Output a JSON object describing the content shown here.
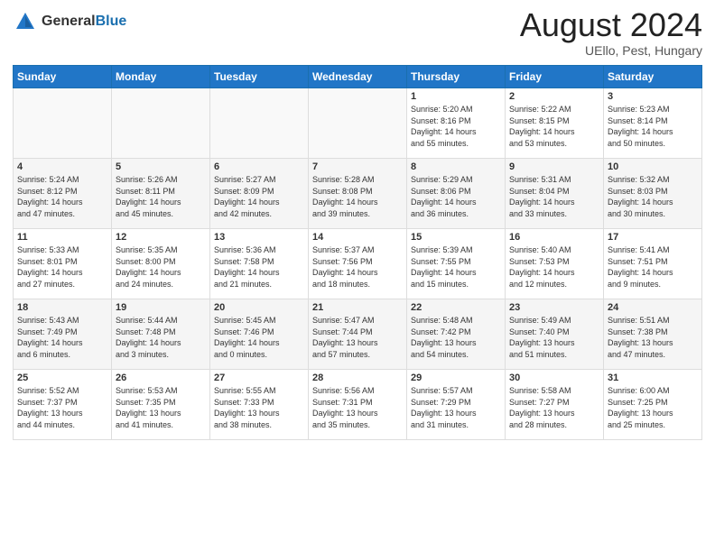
{
  "header": {
    "logo_general": "General",
    "logo_blue": "Blue",
    "month_title": "August 2024",
    "location": "UEllo, Pest, Hungary"
  },
  "days_of_week": [
    "Sunday",
    "Monday",
    "Tuesday",
    "Wednesday",
    "Thursday",
    "Friday",
    "Saturday"
  ],
  "weeks": [
    [
      {
        "day": "",
        "text": ""
      },
      {
        "day": "",
        "text": ""
      },
      {
        "day": "",
        "text": ""
      },
      {
        "day": "",
        "text": ""
      },
      {
        "day": "1",
        "text": "Sunrise: 5:20 AM\nSunset: 8:16 PM\nDaylight: 14 hours\nand 55 minutes."
      },
      {
        "day": "2",
        "text": "Sunrise: 5:22 AM\nSunset: 8:15 PM\nDaylight: 14 hours\nand 53 minutes."
      },
      {
        "day": "3",
        "text": "Sunrise: 5:23 AM\nSunset: 8:14 PM\nDaylight: 14 hours\nand 50 minutes."
      }
    ],
    [
      {
        "day": "4",
        "text": "Sunrise: 5:24 AM\nSunset: 8:12 PM\nDaylight: 14 hours\nand 47 minutes."
      },
      {
        "day": "5",
        "text": "Sunrise: 5:26 AM\nSunset: 8:11 PM\nDaylight: 14 hours\nand 45 minutes."
      },
      {
        "day": "6",
        "text": "Sunrise: 5:27 AM\nSunset: 8:09 PM\nDaylight: 14 hours\nand 42 minutes."
      },
      {
        "day": "7",
        "text": "Sunrise: 5:28 AM\nSunset: 8:08 PM\nDaylight: 14 hours\nand 39 minutes."
      },
      {
        "day": "8",
        "text": "Sunrise: 5:29 AM\nSunset: 8:06 PM\nDaylight: 14 hours\nand 36 minutes."
      },
      {
        "day": "9",
        "text": "Sunrise: 5:31 AM\nSunset: 8:04 PM\nDaylight: 14 hours\nand 33 minutes."
      },
      {
        "day": "10",
        "text": "Sunrise: 5:32 AM\nSunset: 8:03 PM\nDaylight: 14 hours\nand 30 minutes."
      }
    ],
    [
      {
        "day": "11",
        "text": "Sunrise: 5:33 AM\nSunset: 8:01 PM\nDaylight: 14 hours\nand 27 minutes."
      },
      {
        "day": "12",
        "text": "Sunrise: 5:35 AM\nSunset: 8:00 PM\nDaylight: 14 hours\nand 24 minutes."
      },
      {
        "day": "13",
        "text": "Sunrise: 5:36 AM\nSunset: 7:58 PM\nDaylight: 14 hours\nand 21 minutes."
      },
      {
        "day": "14",
        "text": "Sunrise: 5:37 AM\nSunset: 7:56 PM\nDaylight: 14 hours\nand 18 minutes."
      },
      {
        "day": "15",
        "text": "Sunrise: 5:39 AM\nSunset: 7:55 PM\nDaylight: 14 hours\nand 15 minutes."
      },
      {
        "day": "16",
        "text": "Sunrise: 5:40 AM\nSunset: 7:53 PM\nDaylight: 14 hours\nand 12 minutes."
      },
      {
        "day": "17",
        "text": "Sunrise: 5:41 AM\nSunset: 7:51 PM\nDaylight: 14 hours\nand 9 minutes."
      }
    ],
    [
      {
        "day": "18",
        "text": "Sunrise: 5:43 AM\nSunset: 7:49 PM\nDaylight: 14 hours\nand 6 minutes."
      },
      {
        "day": "19",
        "text": "Sunrise: 5:44 AM\nSunset: 7:48 PM\nDaylight: 14 hours\nand 3 minutes."
      },
      {
        "day": "20",
        "text": "Sunrise: 5:45 AM\nSunset: 7:46 PM\nDaylight: 14 hours\nand 0 minutes."
      },
      {
        "day": "21",
        "text": "Sunrise: 5:47 AM\nSunset: 7:44 PM\nDaylight: 13 hours\nand 57 minutes."
      },
      {
        "day": "22",
        "text": "Sunrise: 5:48 AM\nSunset: 7:42 PM\nDaylight: 13 hours\nand 54 minutes."
      },
      {
        "day": "23",
        "text": "Sunrise: 5:49 AM\nSunset: 7:40 PM\nDaylight: 13 hours\nand 51 minutes."
      },
      {
        "day": "24",
        "text": "Sunrise: 5:51 AM\nSunset: 7:38 PM\nDaylight: 13 hours\nand 47 minutes."
      }
    ],
    [
      {
        "day": "25",
        "text": "Sunrise: 5:52 AM\nSunset: 7:37 PM\nDaylight: 13 hours\nand 44 minutes."
      },
      {
        "day": "26",
        "text": "Sunrise: 5:53 AM\nSunset: 7:35 PM\nDaylight: 13 hours\nand 41 minutes."
      },
      {
        "day": "27",
        "text": "Sunrise: 5:55 AM\nSunset: 7:33 PM\nDaylight: 13 hours\nand 38 minutes."
      },
      {
        "day": "28",
        "text": "Sunrise: 5:56 AM\nSunset: 7:31 PM\nDaylight: 13 hours\nand 35 minutes."
      },
      {
        "day": "29",
        "text": "Sunrise: 5:57 AM\nSunset: 7:29 PM\nDaylight: 13 hours\nand 31 minutes."
      },
      {
        "day": "30",
        "text": "Sunrise: 5:58 AM\nSunset: 7:27 PM\nDaylight: 13 hours\nand 28 minutes."
      },
      {
        "day": "31",
        "text": "Sunrise: 6:00 AM\nSunset: 7:25 PM\nDaylight: 13 hours\nand 25 minutes."
      }
    ]
  ]
}
